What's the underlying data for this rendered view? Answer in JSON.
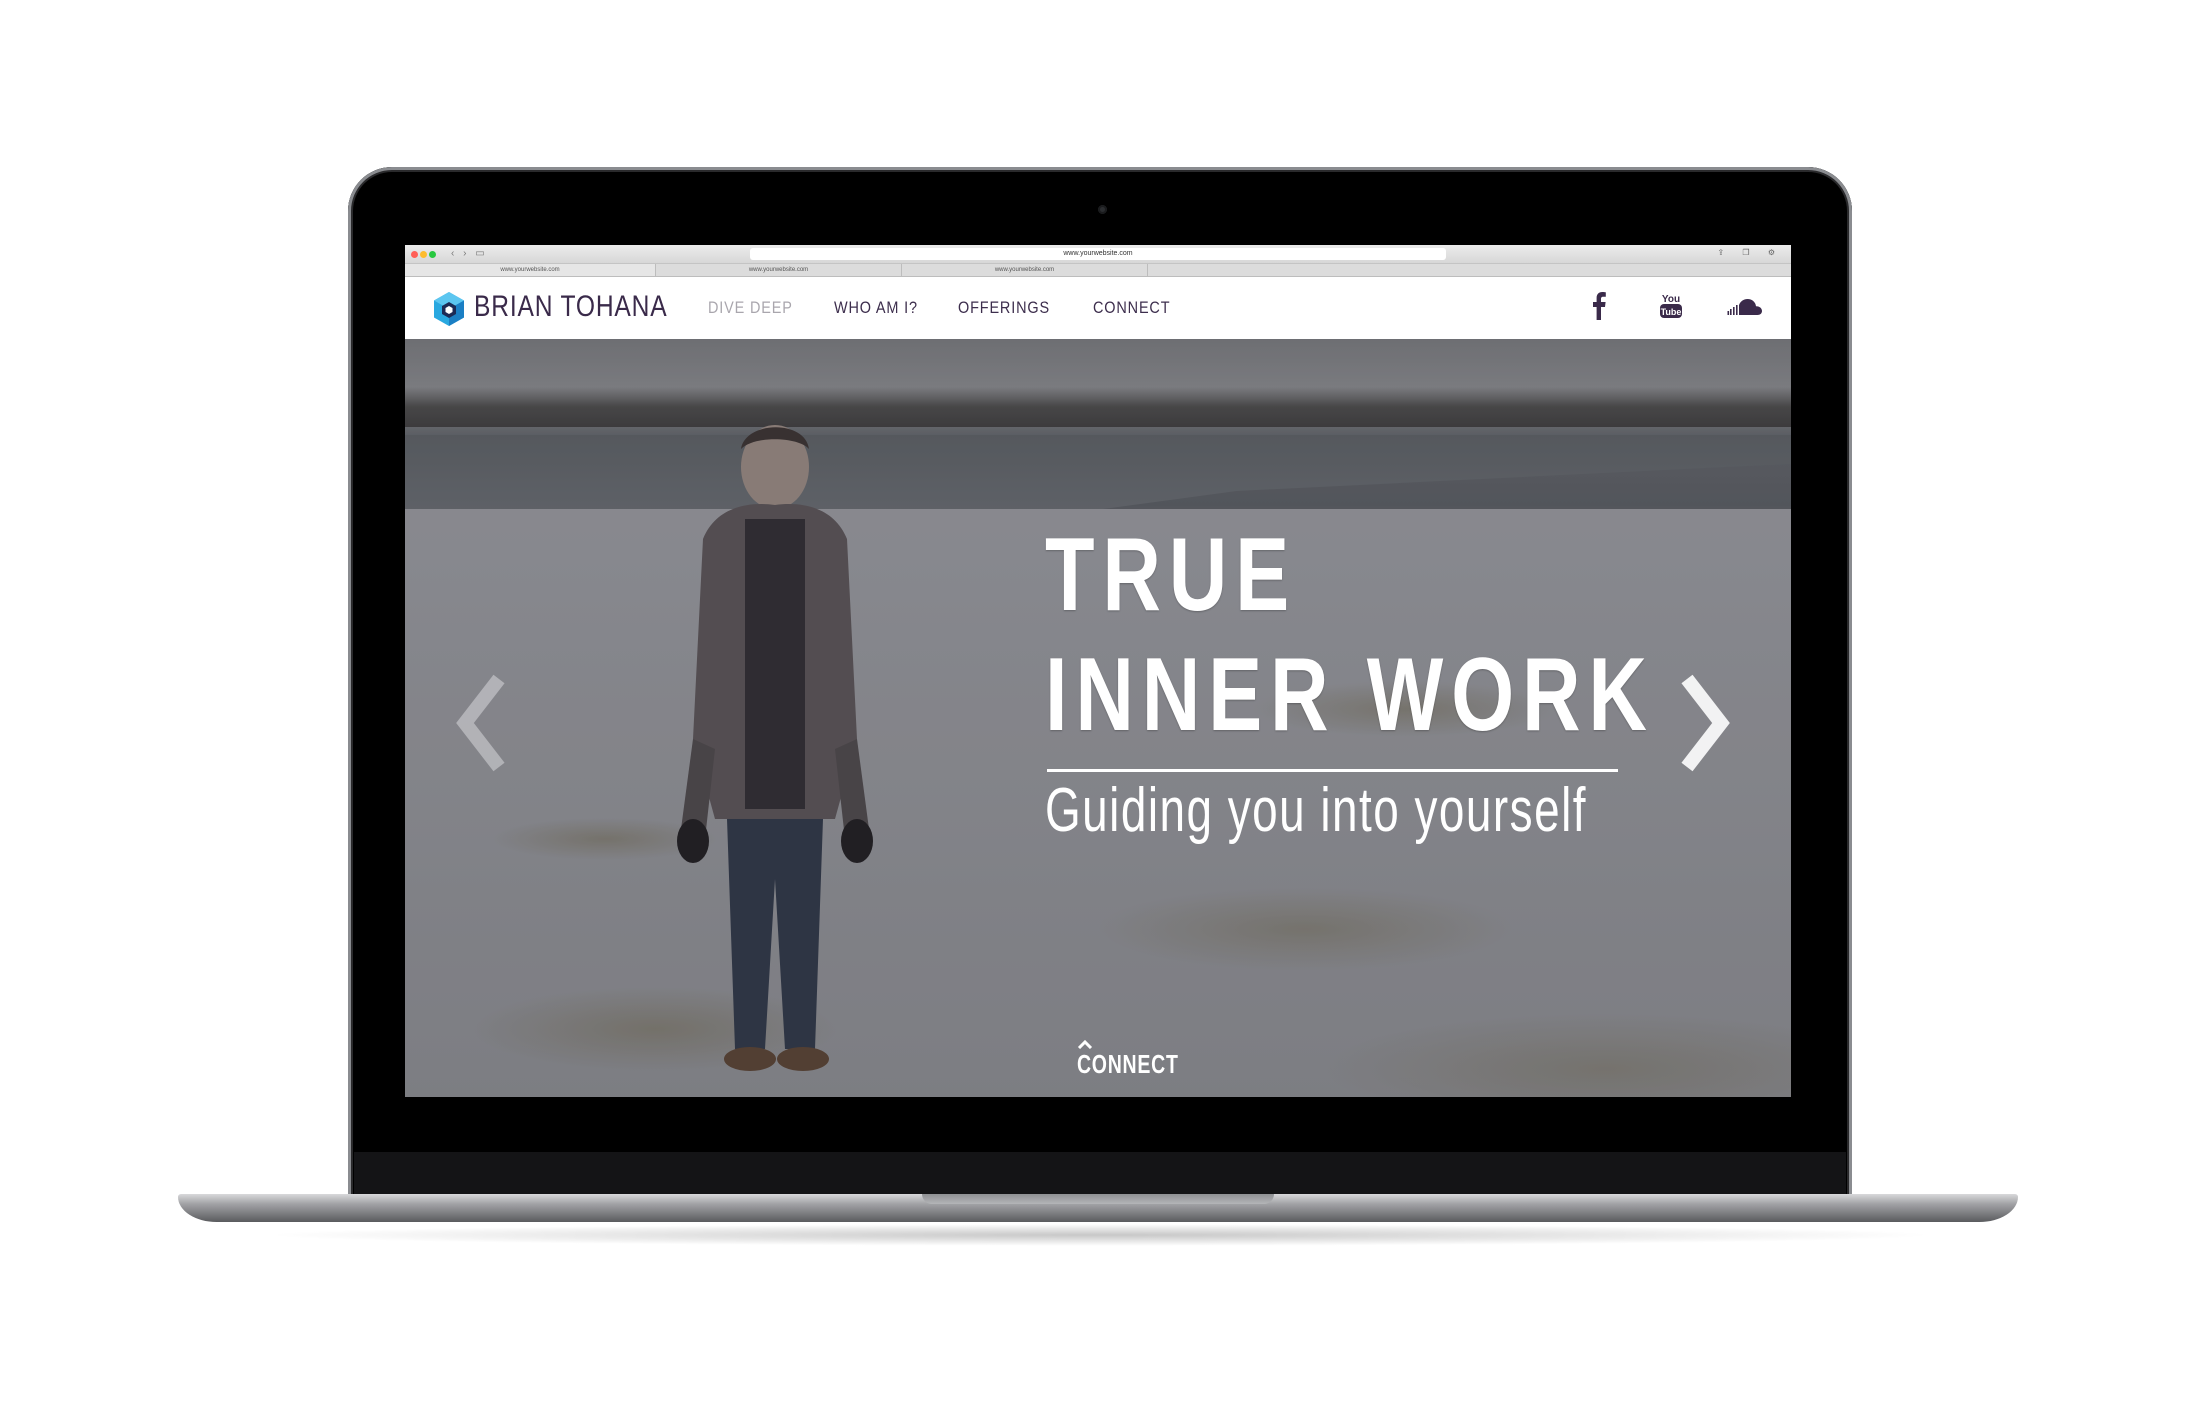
{
  "browser": {
    "address": "www.yourwebsite.com",
    "tabs": [
      "www.yourwebsite.com",
      "www.yourwebsite.com",
      "www.yourwebsite.com"
    ]
  },
  "site": {
    "brand": "BRIAN TOHANA",
    "menu": [
      "DIVE DEEP",
      "WHO AM I?",
      "OFFERINGS",
      "CONNECT"
    ],
    "active_menu": "DIVE DEEP",
    "social": [
      "facebook-icon",
      "youtube-icon",
      "soundcloud-icon"
    ]
  },
  "hero": {
    "line1": "TRUE",
    "line2": "INNER WORK",
    "subtitle": "Guiding you into yourself",
    "connect": "CONNECT"
  },
  "colors": {
    "brand_purple": "#3a2a4a",
    "menu_active": "#a9a6ad",
    "logo_blue": "#29a8e0"
  }
}
